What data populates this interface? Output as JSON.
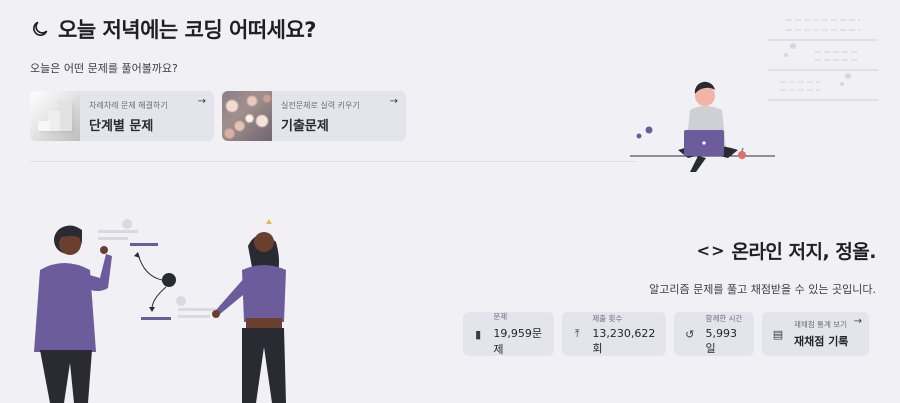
{
  "hero": {
    "title": "오늘 저녁에는 코딩 어떠세요?",
    "title_icon": "moon-icon",
    "subtitle": "오늘은 어떤 문제를 풀어볼까요?"
  },
  "cards": [
    {
      "small": "차례차례 문제 해결하기",
      "big": "단계별 문제",
      "thumb": "stairs",
      "arrow": "→"
    },
    {
      "small": "실전문제로 실력 키우기",
      "big": "기출문제",
      "thumb": "bokeh",
      "arrow": "→"
    }
  ],
  "bottom": {
    "title": "온라인 저지, 정올.",
    "title_icon": "<>",
    "subtitle": "알고리즘 문제를 풀고 채점받을 수 있는 곳입니다."
  },
  "stats": [
    {
      "label": "문제",
      "value": "19,959문제",
      "icon": "document-icon",
      "glyph": "▮"
    },
    {
      "label": "제출 횟수",
      "value": "13,230,622회",
      "icon": "upload-icon",
      "glyph": "⤒"
    },
    {
      "label": "함께한 시간",
      "value": "5,993일",
      "icon": "history-icon",
      "glyph": "↺"
    },
    {
      "label": "재채점 통계 보기",
      "value": "재채점 기록",
      "icon": "report-icon",
      "glyph": "▤",
      "arrow": "→"
    }
  ],
  "colors": {
    "background": "#f1f1f5",
    "card": "#e4e4ec",
    "accent_purple": "#6c5c9c",
    "text": "#1f1f24"
  }
}
